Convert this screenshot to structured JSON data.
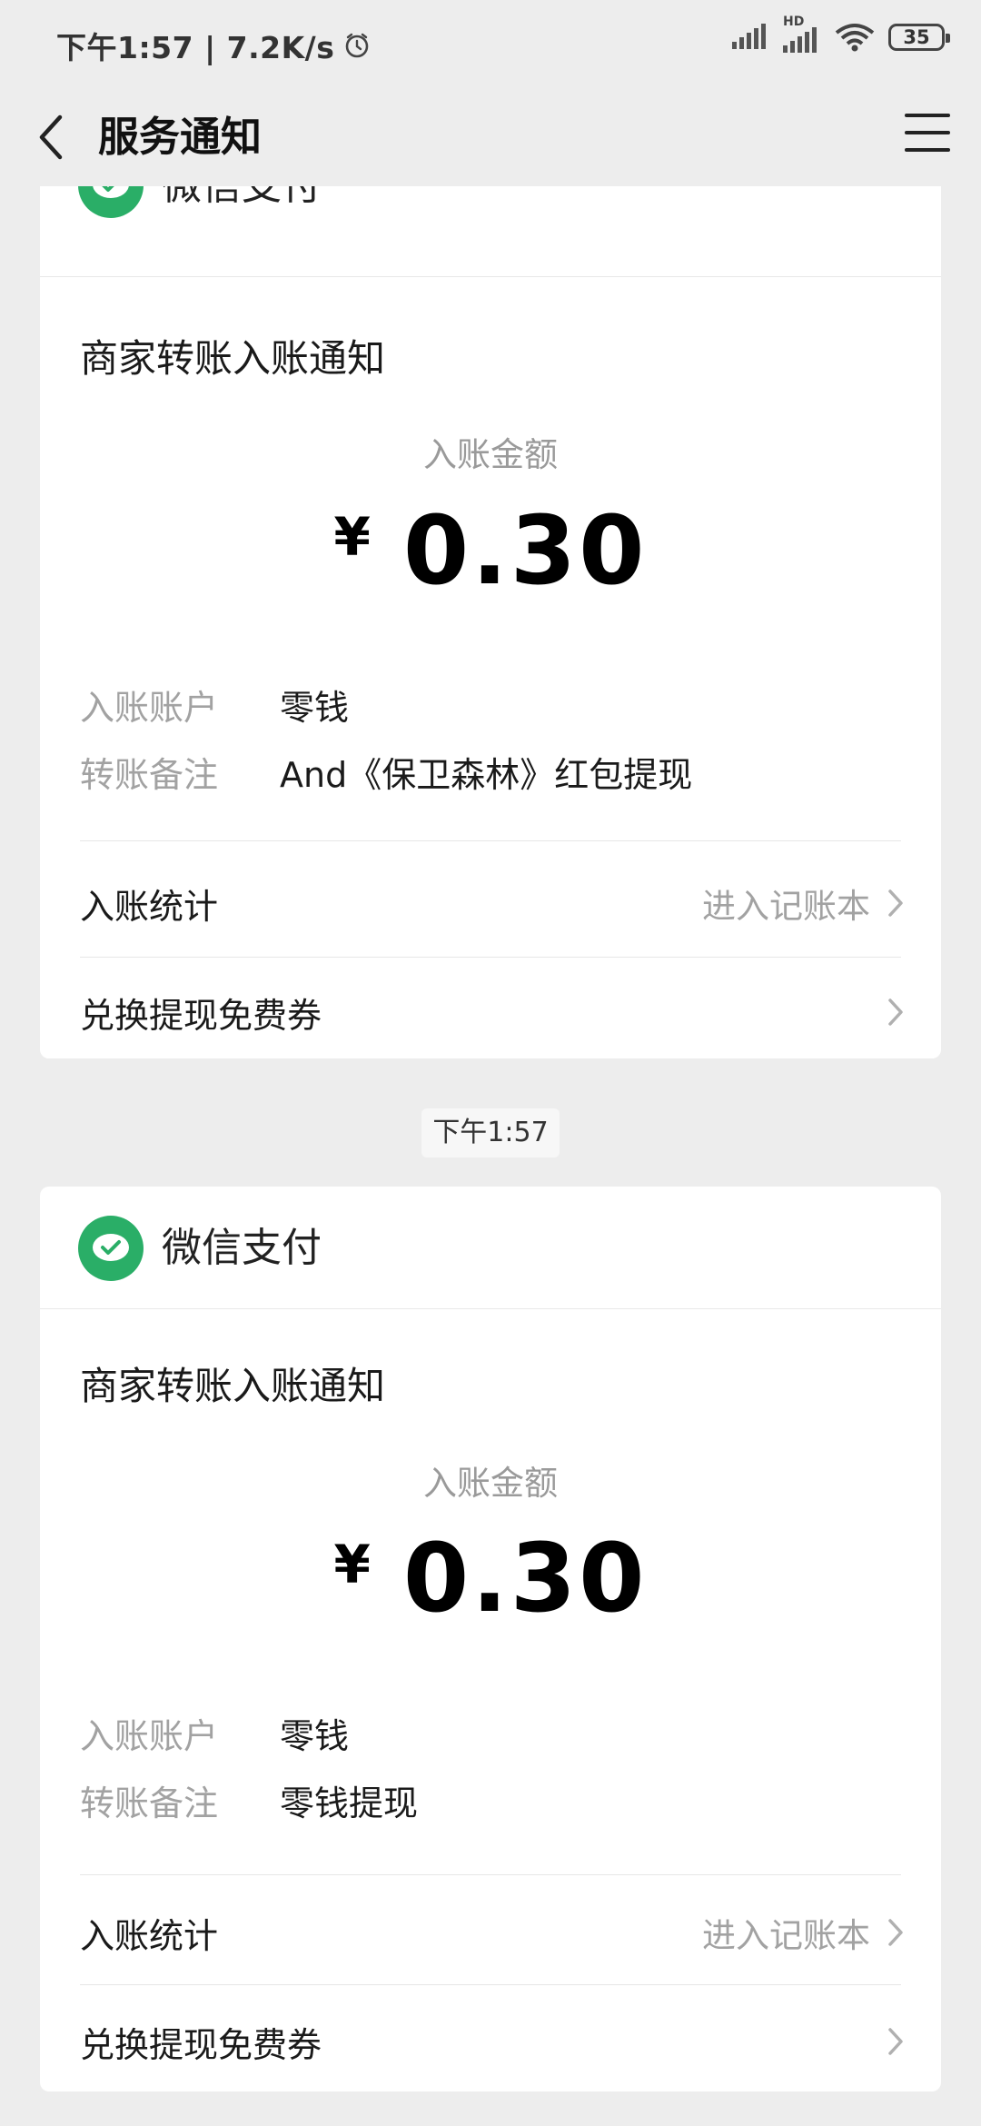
{
  "status_bar": {
    "time_speed": "下午1:57 | 7.2K/s",
    "network_label": "HD",
    "battery": "35"
  },
  "nav": {
    "title": "服务通知"
  },
  "colors": {
    "wechat_green": "#2aae67",
    "background": "#ededed"
  },
  "timestamp": "下午1:57",
  "cards": [
    {
      "app_name": "微信支付",
      "notice_title": "商家转账入账通知",
      "amount_label": "入账金额",
      "currency": "¥",
      "amount": "0.30",
      "account_key": "入账账户",
      "account_value": "零钱",
      "remark_key": "转账备注",
      "remark_value": "And《保卫森林》红包提现",
      "stats_label": "入账统计",
      "stats_link": "进入记账本",
      "coupon_label": "兑换提现免费券"
    },
    {
      "app_name": "微信支付",
      "notice_title": "商家转账入账通知",
      "amount_label": "入账金额",
      "currency": "¥",
      "amount": "0.30",
      "account_key": "入账账户",
      "account_value": "零钱",
      "remark_key": "转账备注",
      "remark_value": "零钱提现",
      "stats_label": "入账统计",
      "stats_link": "进入记账本",
      "coupon_label": "兑换提现免费券"
    }
  ]
}
